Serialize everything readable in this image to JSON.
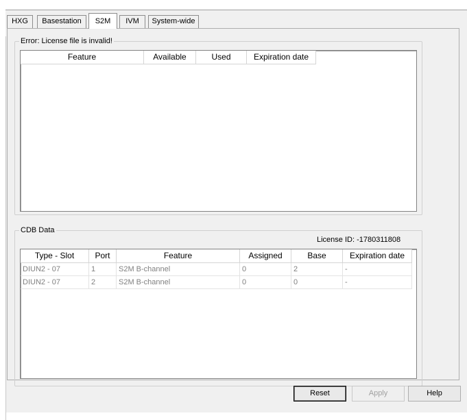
{
  "tabs": [
    "HXG",
    "Basestation",
    "S2M",
    "IVM",
    "System-wide"
  ],
  "active_tab": "S2M",
  "license_group": {
    "title": "Error: License file is invalid!",
    "columns": [
      "Feature",
      "Available",
      "Used",
      "Expiration date"
    ]
  },
  "cdb_group": {
    "title": "CDB Data",
    "license_id": "License ID: -1780311808",
    "columns": [
      "Type - Slot",
      "Port",
      "Feature",
      "Assigned",
      "Base",
      "Expiration date"
    ],
    "rows": [
      [
        "DIUN2 - 07",
        "1",
        "S2M B-channel",
        "0",
        "2",
        "-"
      ],
      [
        "DIUN2 - 07",
        "2",
        "S2M B-channel",
        "0",
        "0",
        "-"
      ]
    ]
  },
  "buttons": {
    "reset": "Reset",
    "apply": "Apply",
    "help": "Help"
  }
}
